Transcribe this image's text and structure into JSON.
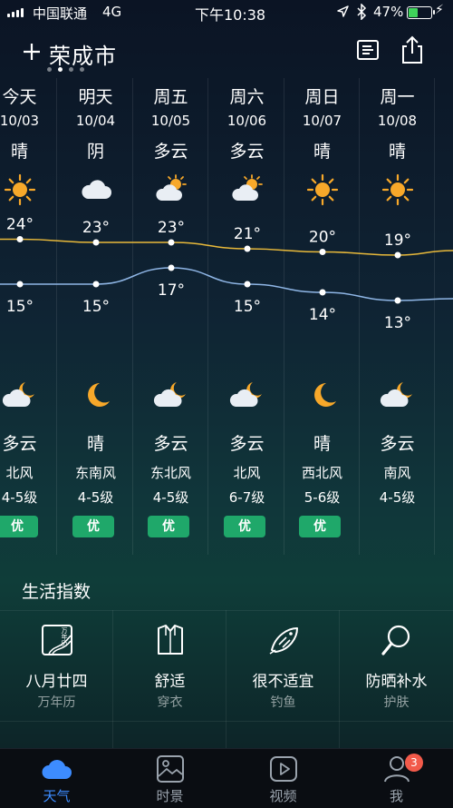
{
  "status_bar": {
    "carrier": "中国联通",
    "network": "4G",
    "time": "下午10:38",
    "battery_pct": "47%",
    "battery_level": 0.47
  },
  "header": {
    "add_icon": "plus-icon",
    "city": "荣成市",
    "list_icon": "list-icon",
    "share_icon": "share-icon",
    "page_count": 4,
    "current_page": 2
  },
  "forecast": {
    "days": [
      {
        "day": "今天",
        "date": "10/03",
        "day_weather": "晴",
        "day_icon": "sun-icon",
        "high": "24°",
        "low": "15°",
        "night_icon": "cloud-moon-icon",
        "night_weather": "多云",
        "wind": "北风",
        "level": "4-5级",
        "aqi": "优"
      },
      {
        "day": "明天",
        "date": "10/04",
        "day_weather": "阴",
        "day_icon": "cloud-icon",
        "high": "23°",
        "low": "15°",
        "night_icon": "moon-icon",
        "night_weather": "晴",
        "wind": "东南风",
        "level": "4-5级",
        "aqi": "优"
      },
      {
        "day": "周五",
        "date": "10/05",
        "day_weather": "多云",
        "day_icon": "cloud-sun-icon",
        "high": "23°",
        "low": "17°",
        "night_icon": "cloud-moon-icon",
        "night_weather": "多云",
        "wind": "东北风",
        "level": "4-5级",
        "aqi": "优"
      },
      {
        "day": "周六",
        "date": "10/06",
        "day_weather": "多云",
        "day_icon": "cloud-sun-icon",
        "high": "21°",
        "low": "15°",
        "night_icon": "cloud-moon-icon",
        "night_weather": "多云",
        "wind": "北风",
        "level": "6-7级",
        "aqi": "优"
      },
      {
        "day": "周日",
        "date": "10/07",
        "day_weather": "晴",
        "day_icon": "sun-icon",
        "high": "20°",
        "low": "14°",
        "night_icon": "moon-icon",
        "night_weather": "晴",
        "wind": "西北风",
        "level": "5-6级",
        "aqi": "优"
      },
      {
        "day": "周一",
        "date": "10/08",
        "day_weather": "晴",
        "day_icon": "sun-icon",
        "high": "19°",
        "low": "13°",
        "night_icon": "cloud-moon-icon",
        "night_weather": "多云",
        "wind": "南风",
        "level": "4-5级",
        "aqi": ""
      }
    ],
    "colors": {
      "high_line": "#e8b93a",
      "low_line": "#8fb6e6",
      "aqi_good": "#1fa86a"
    }
  },
  "life": {
    "title": "生活指数",
    "items": [
      {
        "icon": "calendar-icon",
        "icon_text": "万年历",
        "value": "八月廿四",
        "label": "万年历"
      },
      {
        "icon": "shirt-icon",
        "value": "舒适",
        "label": "穿衣"
      },
      {
        "icon": "fish-icon",
        "value": "很不适宜",
        "label": "钓鱼"
      },
      {
        "icon": "magnifier-icon",
        "value": "防晒补水",
        "label": "护肤"
      }
    ]
  },
  "tabs": [
    {
      "label": "天气",
      "icon": "cloud-tab-icon",
      "active": true
    },
    {
      "label": "时景",
      "icon": "photo-icon",
      "active": false
    },
    {
      "label": "视频",
      "icon": "play-icon",
      "active": false
    },
    {
      "label": "我",
      "icon": "person-icon",
      "active": false,
      "badge": "3"
    }
  ]
}
